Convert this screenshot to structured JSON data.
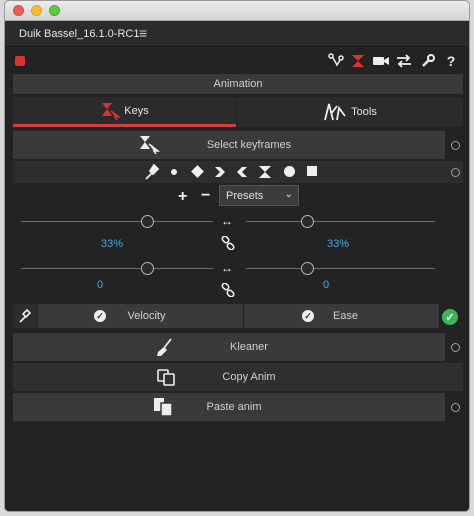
{
  "window": {
    "title": "Duik Bassel_16.1.0-RC1"
  },
  "toolbar": {
    "icons": [
      "rig-icon",
      "animation-icon",
      "camera-icon",
      "io-icon",
      "settings-icon"
    ]
  },
  "section": {
    "title": "Animation"
  },
  "tabs": [
    {
      "label": "Keys",
      "active": true
    },
    {
      "label": "Tools",
      "active": false
    }
  ],
  "keys": {
    "select_keyframes": "Select keyframes",
    "presets": "Presets",
    "influence": {
      "left": "33%",
      "right": "33%"
    },
    "velocity_values": {
      "left": "0",
      "right": "0"
    },
    "velocity_label": "Velocity",
    "ease_label": "Ease"
  },
  "tools": {
    "kleaner": "Kleaner",
    "copy_anim": "Copy Anim",
    "paste_anim": "Paste anim"
  },
  "colors": {
    "accent_red": "#e0302e",
    "value_blue": "#4aa7e6",
    "ok_green": "#3cb55a"
  }
}
